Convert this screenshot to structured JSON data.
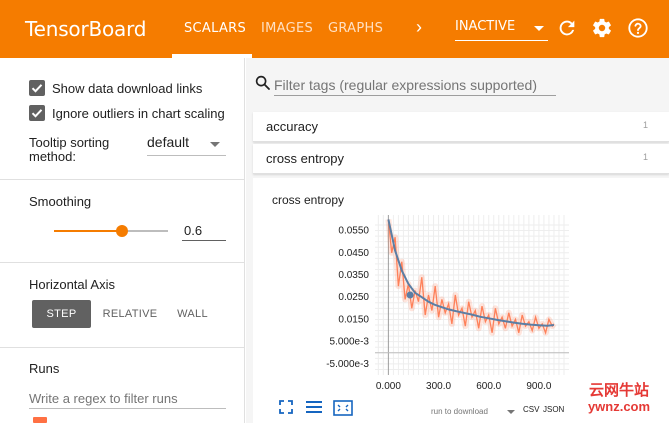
{
  "header": {
    "brand": "TensorBoard",
    "tabs": [
      {
        "label": "SCALARS",
        "active": true
      },
      {
        "label": "IMAGES",
        "active": false
      },
      {
        "label": "GRAPHS",
        "active": false
      }
    ],
    "more_tabs": "›",
    "inactive_select": "INACTIVE",
    "icons": [
      "chevron-right-icon",
      "refresh-icon",
      "settings-gear-icon",
      "help-icon"
    ],
    "bar_color": "#f57c00"
  },
  "sidebar": {
    "show_download_links": {
      "label": "Show data download links",
      "checked": true
    },
    "ignore_outliers": {
      "label": "Ignore outliers in chart scaling",
      "checked": true
    },
    "tooltip_sorting": {
      "label": "Tooltip sorting method:",
      "value": "default"
    },
    "smoothing": {
      "label": "Smoothing",
      "value": "0.6",
      "level": 0.6
    },
    "horizontal_axis": {
      "label": "Horizontal Axis",
      "options": [
        {
          "label": "STEP",
          "active": true
        },
        {
          "label": "RELATIVE",
          "active": false
        },
        {
          "label": "WALL",
          "active": false
        }
      ]
    },
    "runs": {
      "label": "Runs",
      "filter_placeholder": "Write a regex to filter runs"
    }
  },
  "main": {
    "search_placeholder": "Filter tags (regular expressions supported)",
    "tags": [
      {
        "name": "accuracy",
        "count": "1"
      },
      {
        "name": "cross entropy",
        "count": "1"
      }
    ],
    "chart_footer": {
      "icons": [
        "expand-icon",
        "list-icon",
        "fit-domain-icon"
      ],
      "download_label": "run to download",
      "csv": "CSV",
      "json": "JSON"
    }
  },
  "watermark": {
    "cn": "云网牛站",
    "en": "ywnz.com"
  },
  "chart_data": {
    "type": "line",
    "title": "cross entropy",
    "xlabel": "",
    "ylabel": "",
    "x_ticks": [
      "0.000",
      "300.0",
      "600.0",
      "900.0"
    ],
    "y_ticks": [
      "0.0550",
      "0.0450",
      "0.0350",
      "0.0250",
      "0.0150",
      "5.000e-3",
      "-5.000e-3"
    ],
    "xlim": [
      -80,
      1080
    ],
    "ylim": [
      -0.01,
      0.062
    ],
    "grid": true,
    "series": [
      {
        "role": "raw",
        "color": "#ff7043",
        "x": [
          0,
          20,
          40,
          60,
          80,
          100,
          120,
          140,
          160,
          180,
          200,
          220,
          240,
          260,
          280,
          300,
          320,
          340,
          360,
          380,
          400,
          420,
          440,
          460,
          480,
          500,
          520,
          540,
          560,
          580,
          600,
          620,
          640,
          660,
          680,
          700,
          720,
          740,
          760,
          780,
          800,
          820,
          840,
          860,
          880,
          900,
          920,
          940,
          960,
          980,
          990
        ],
        "values": [
          0.06,
          0.045,
          0.052,
          0.03,
          0.041,
          0.024,
          0.031,
          0.02,
          0.028,
          0.023,
          0.034,
          0.017,
          0.026,
          0.019,
          0.03,
          0.016,
          0.024,
          0.018,
          0.022,
          0.013,
          0.026,
          0.017,
          0.02,
          0.012,
          0.023,
          0.016,
          0.019,
          0.011,
          0.021,
          0.014,
          0.017,
          0.009,
          0.02,
          0.013,
          0.016,
          0.011,
          0.018,
          0.012,
          0.015,
          0.009,
          0.017,
          0.012,
          0.014,
          0.01,
          0.016,
          0.011,
          0.013,
          0.009,
          0.015,
          0.012,
          0.013
        ]
      },
      {
        "role": "smoothed",
        "color": "#5b7ea4",
        "x": [
          0,
          40,
          80,
          120,
          160,
          200,
          240,
          280,
          320,
          360,
          400,
          450,
          500,
          550,
          600,
          650,
          700,
          750,
          800,
          850,
          900,
          950,
          990
        ],
        "values": [
          0.06,
          0.046,
          0.037,
          0.031,
          0.027,
          0.025,
          0.023,
          0.0215,
          0.0205,
          0.0195,
          0.0188,
          0.018,
          0.0172,
          0.0162,
          0.0155,
          0.0148,
          0.0142,
          0.0136,
          0.0131,
          0.0127,
          0.0124,
          0.0122,
          0.0125
        ]
      }
    ],
    "highlight_point": {
      "x": 130,
      "y": 0.026
    }
  }
}
